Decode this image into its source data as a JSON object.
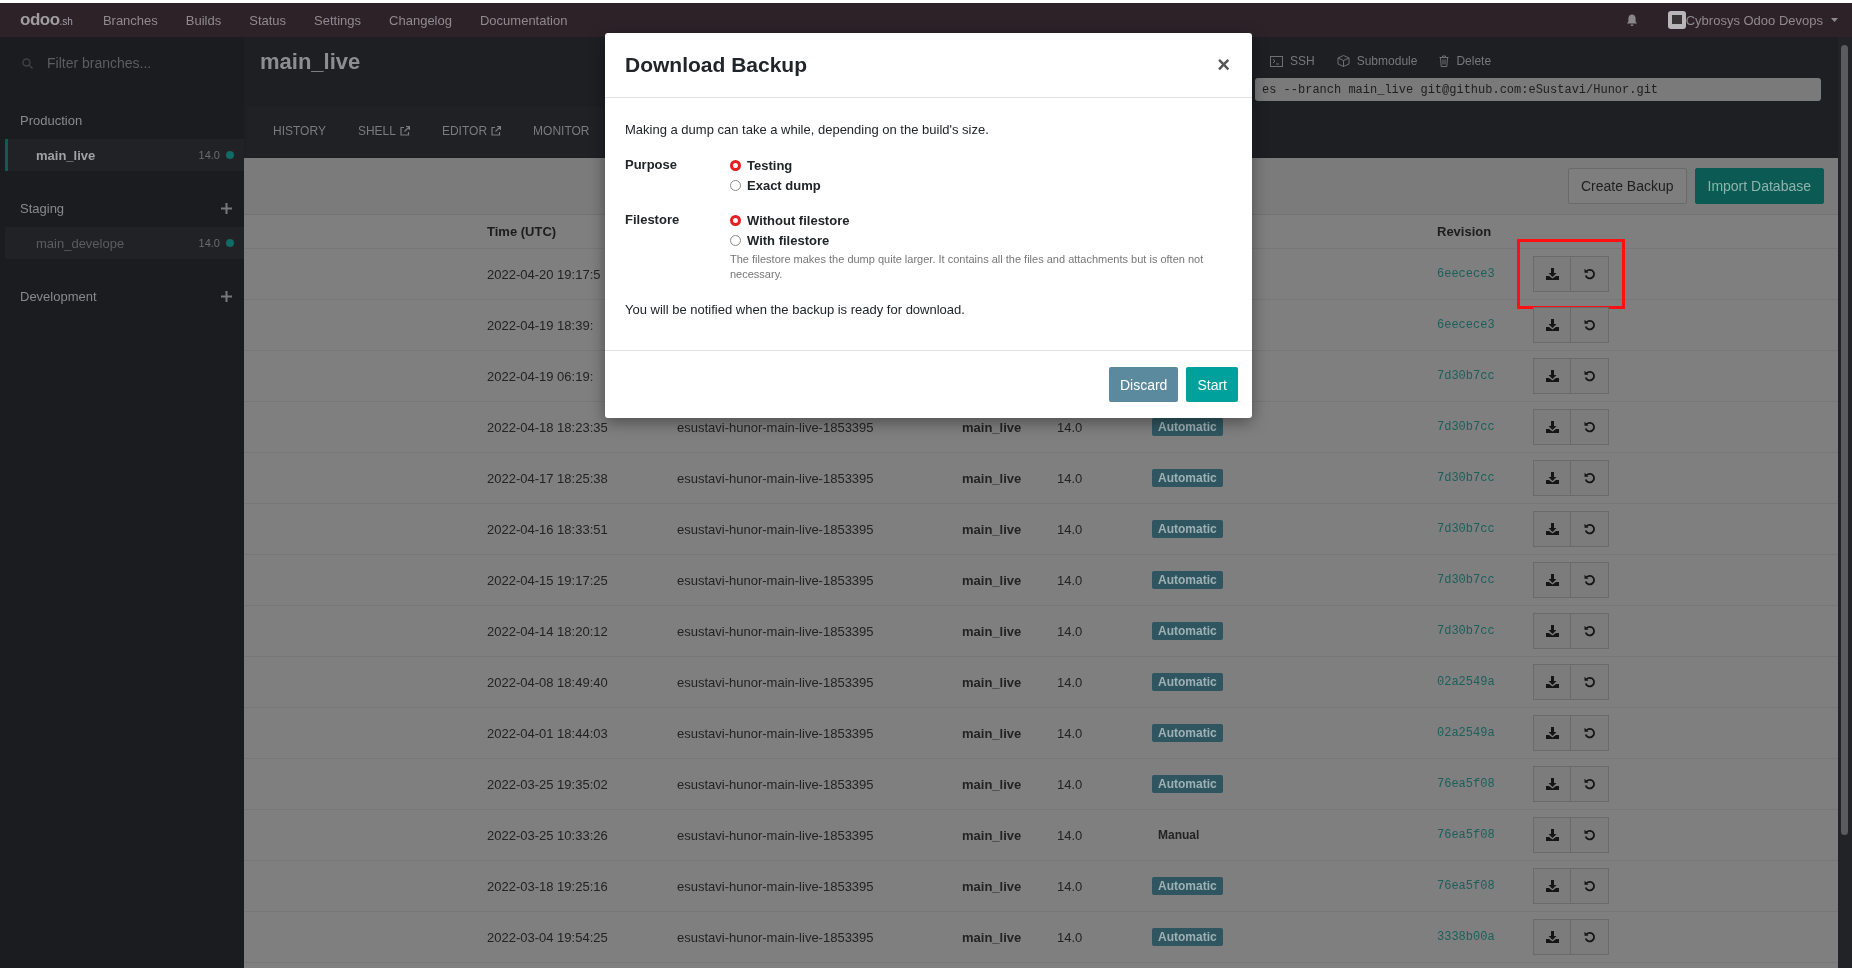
{
  "topbar": {
    "logo": "odoo",
    "logo_suffix": ".sh",
    "nav": [
      "Branches",
      "Builds",
      "Status",
      "Settings",
      "Changelog",
      "Documentation"
    ],
    "account": "Cybrosys Odoo Devops"
  },
  "sidebar": {
    "search_placeholder": "Filter branches...",
    "groups": [
      {
        "title": "Production",
        "can_add": false,
        "branches": [
          {
            "name": "main_live",
            "version": "14.0",
            "selected": true
          }
        ]
      },
      {
        "title": "Staging",
        "can_add": true,
        "branches": [
          {
            "name": "main_develope",
            "version": "14.0",
            "selected": false
          }
        ]
      },
      {
        "title": "Development",
        "can_add": true
      }
    ]
  },
  "branch": {
    "title": "main_live",
    "tabs": [
      {
        "label": "HISTORY",
        "selected": false,
        "external": false
      },
      {
        "label": "SHELL",
        "selected": false,
        "external": true
      },
      {
        "label": "EDITOR",
        "selected": false,
        "external": true
      },
      {
        "label": "MONITOR",
        "selected": false,
        "external": false
      }
    ],
    "actions": [
      {
        "label": "SSH",
        "kind": "terminal"
      },
      {
        "label": "Submodule",
        "kind": "cube"
      },
      {
        "label": "Delete",
        "kind": "trash"
      }
    ],
    "clone_command": "es --branch main_live git@github.com:eSustavi/Hunor.git"
  },
  "backups": {
    "buttons": [
      {
        "label": "Create Backup",
        "kind": "secondary"
      },
      {
        "label": "Import Database",
        "kind": "primary"
      }
    ],
    "columns": {
      "time": "Time (UTC)",
      "revision": "Revision"
    },
    "rows": [
      {
        "time": "2022-04-20 19:17:5",
        "revision": "6eecece3",
        "highlighted": true
      },
      {
        "time": "2022-04-19 18:39:",
        "revision": "6eecece3",
        "highlighted": false
      },
      {
        "time": "2022-04-19 06:19:",
        "revision": "7d30b7cc",
        "highlighted": false
      },
      {
        "time": "2022-04-18 18:23:35",
        "name": "esustavi-hunor-main-live-1853395",
        "branch": "main_live",
        "version": "14.0",
        "trigger": "Automatic",
        "kind": "badge",
        "revision": "7d30b7cc",
        "highlighted": false
      },
      {
        "time": "2022-04-17 18:25:38",
        "name": "esustavi-hunor-main-live-1853395",
        "branch": "main_live",
        "version": "14.0",
        "trigger": "Automatic",
        "kind": "badge",
        "revision": "7d30b7cc",
        "highlighted": false
      },
      {
        "time": "2022-04-16 18:33:51",
        "name": "esustavi-hunor-main-live-1853395",
        "branch": "main_live",
        "version": "14.0",
        "trigger": "Automatic",
        "kind": "badge",
        "revision": "7d30b7cc",
        "highlighted": false
      },
      {
        "time": "2022-04-15 19:17:25",
        "name": "esustavi-hunor-main-live-1853395",
        "branch": "main_live",
        "version": "14.0",
        "trigger": "Automatic",
        "kind": "badge",
        "revision": "7d30b7cc",
        "highlighted": false
      },
      {
        "time": "2022-04-14 18:20:12",
        "name": "esustavi-hunor-main-live-1853395",
        "branch": "main_live",
        "version": "14.0",
        "trigger": "Automatic",
        "kind": "badge",
        "revision": "7d30b7cc",
        "highlighted": false
      },
      {
        "time": "2022-04-08 18:49:40",
        "name": "esustavi-hunor-main-live-1853395",
        "branch": "main_live",
        "version": "14.0",
        "trigger": "Automatic",
        "kind": "badge",
        "revision": "02a2549a",
        "highlighted": false
      },
      {
        "time": "2022-04-01 18:44:03",
        "name": "esustavi-hunor-main-live-1853395",
        "branch": "main_live",
        "version": "14.0",
        "trigger": "Automatic",
        "kind": "badge",
        "revision": "02a2549a",
        "highlighted": false
      },
      {
        "time": "2022-03-25 19:35:02",
        "name": "esustavi-hunor-main-live-1853395",
        "branch": "main_live",
        "version": "14.0",
        "trigger": "Automatic",
        "kind": "badge",
        "revision": "76ea5f08",
        "highlighted": false
      },
      {
        "time": "2022-03-25 10:33:26",
        "name": "esustavi-hunor-main-live-1853395",
        "branch": "main_live",
        "version": "14.0",
        "trigger": "Manual",
        "kind": "plain",
        "revision": "76ea5f08",
        "highlighted": false
      },
      {
        "time": "2022-03-18 19:25:16",
        "name": "esustavi-hunor-main-live-1853395",
        "branch": "main_live",
        "version": "14.0",
        "trigger": "Automatic",
        "kind": "badge",
        "revision": "76ea5f08",
        "highlighted": false
      },
      {
        "time": "2022-03-04 19:54:25",
        "name": "esustavi-hunor-main-live-1853395",
        "branch": "main_live",
        "version": "14.0",
        "trigger": "Automatic",
        "kind": "badge",
        "revision": "3338b00a",
        "highlighted": false
      }
    ]
  },
  "modal": {
    "title": "Download Backup",
    "close": "×",
    "intro": "Making a dump can take a while, depending on the build's size.",
    "groups": [
      {
        "label": "Purpose",
        "options": [
          {
            "label": "Testing",
            "selected": true
          },
          {
            "label": "Exact dump",
            "selected": false
          }
        ]
      },
      {
        "label": "Filestore",
        "options": [
          {
            "label": "Without filestore",
            "selected": true
          },
          {
            "label": "With filestore",
            "selected": false
          }
        ],
        "help": "The filestore makes the dump quite larger. It contains all the files and attachments but is often not necessary."
      }
    ],
    "note": "You will be notified when the backup is ready for download.",
    "buttons": [
      {
        "label": "Discard",
        "kind": "secondary"
      },
      {
        "label": "Start",
        "kind": "primary"
      }
    ]
  }
}
